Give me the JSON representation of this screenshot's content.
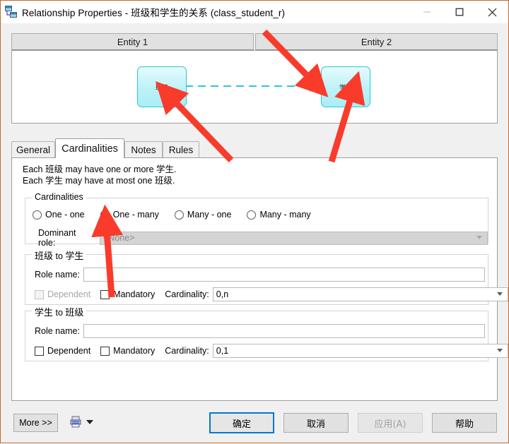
{
  "window": {
    "title": "Relationship Properties - 班级和学生的关系 (class_student_r)",
    "icon": "relationship-icon",
    "controls": {
      "minimize": "—",
      "maximize": "☐",
      "close": "✕"
    }
  },
  "diagram": {
    "headers": [
      "Entity 1",
      "Entity 2"
    ],
    "entity_1": "班级",
    "entity_2": "学生",
    "connector": {
      "style": "dashed",
      "color": "#2ec6d2",
      "end_symbol": "crow-foot"
    }
  },
  "tabs": [
    {
      "label": "General",
      "active": false
    },
    {
      "label": "Cardinalities",
      "active": true
    },
    {
      "label": "Notes",
      "active": false
    },
    {
      "label": "Rules",
      "active": false
    }
  ],
  "description": {
    "line1_pre": "Each ",
    "line1_a": "班级",
    "line1_mid": " may have one or more ",
    "line1_b": "学生",
    "line1_end": ".",
    "line2_pre": "Each ",
    "line2_a": "学生",
    "line2_mid": " may have at most one ",
    "line2_b": "班级",
    "line2_end": "."
  },
  "cardinalities": {
    "group_label": "Cardinalities",
    "options": [
      {
        "label": "One - one",
        "selected": false
      },
      {
        "label": "One - many",
        "selected": true
      },
      {
        "label": "Many - one",
        "selected": false
      },
      {
        "label": "Many - many",
        "selected": false
      }
    ],
    "dominant_role": {
      "label": "Dominant role:",
      "value": "<None>",
      "disabled": true
    }
  },
  "role_a": {
    "group_label_from": "班级",
    "group_label_to": " to ",
    "group_label_target": "学生",
    "role_name_label": "Role name:",
    "role_name_value": "",
    "dependent_label": "Dependent",
    "dependent_checked": false,
    "dependent_disabled": true,
    "mandatory_label": "Mandatory",
    "mandatory_checked": false,
    "cardinality_label": "Cardinality:",
    "cardinality_value": "0,n"
  },
  "role_b": {
    "group_label_from": "学生",
    "group_label_to": " to ",
    "group_label_target": "班级",
    "role_name_label": "Role name:",
    "role_name_value": "",
    "dependent_label": "Dependent",
    "dependent_checked": false,
    "dependent_disabled": false,
    "mandatory_label": "Mandatory",
    "mandatory_checked": false,
    "cardinality_label": "Cardinality:",
    "cardinality_value": "0,1"
  },
  "buttons": {
    "more": "More >>",
    "print_icon": "print-report-icon",
    "ok": "确定",
    "cancel": "取消",
    "apply": "应用(A)",
    "apply_disabled": true,
    "help": "帮助"
  },
  "annotations": {
    "color": "#f93b2c",
    "arrows": [
      {
        "name": "arrow-to-crow-foot",
        "target": "crow-foot connector end"
      },
      {
        "name": "arrow-to-entity-1",
        "target": "班级 entity box"
      },
      {
        "name": "arrow-to-entity-2",
        "target": "学生 entity box"
      },
      {
        "name": "arrow-to-cardinalities-tab",
        "target": "Cardinalities tab"
      },
      {
        "name": "arrow-to-one-many-radio",
        "target": "One - many radio"
      }
    ]
  }
}
